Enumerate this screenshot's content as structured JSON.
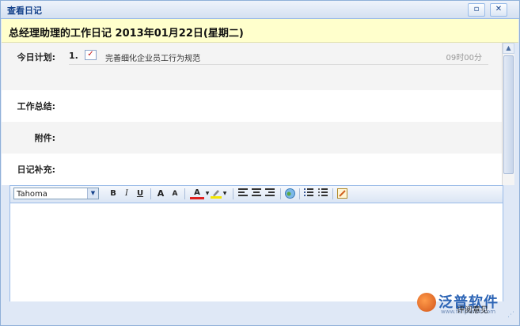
{
  "window": {
    "title": "查看日记",
    "max_icon": "restore-icon",
    "close_icon": "close-icon"
  },
  "diary": {
    "heading": "总经理助理的工作日记 2013年01月22日(星期二)"
  },
  "fields": {
    "plan_label": "今日计划:",
    "summary_label": "工作总结:",
    "attachment_label": "附件:",
    "supplement_label": "日记补充:"
  },
  "plan_items": [
    {
      "num": "1.",
      "text": "完善细化企业员工行为规范",
      "time": "09时00分",
      "checked": true
    }
  ],
  "editor": {
    "font": "Tahoma",
    "tools": {
      "bold": "B",
      "italic": "I",
      "underline": "U",
      "grow": "A",
      "shrink": "A",
      "color": "A"
    }
  },
  "footer": {
    "comment_button": "评阅意见",
    "logo_text": "泛普软件",
    "logo_url": "www.fanpusoft.com"
  }
}
